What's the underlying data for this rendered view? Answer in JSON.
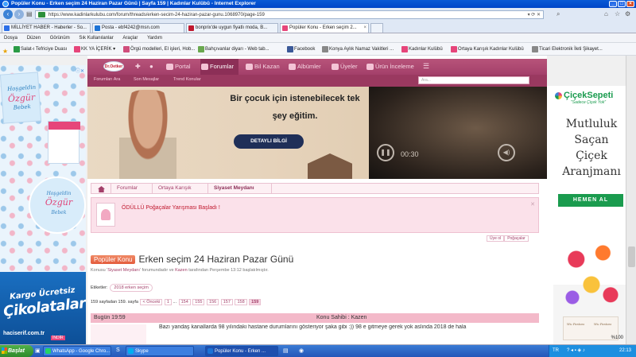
{
  "window": {
    "title": "Popüler Konu - Erken seçim 24 Haziran Pazar Günü | Sayfa 159 | Kadınlar Kulübü - Internet Explorer"
  },
  "address": {
    "url": "https://www.kadinlarkulubu.com/forum/threads/erken-secim-24-haziran-pazar-gunu.1068970/page-159"
  },
  "tabs": [
    {
      "label": "MİLLİYET HABER - Haberler - So...",
      "color": "#2a6ee8"
    },
    {
      "label": "Posta - ebf4242@msn.com",
      "color": "#1c73d6"
    },
    {
      "label": "bonprix'de uygun fiyatlı moda, B...",
      "color": "#c0182e"
    },
    {
      "label": "Popüler Konu - Erken seçim 2...",
      "color": "#e6457a"
    }
  ],
  "menu": [
    "Dosya",
    "Düzen",
    "Görünüm",
    "Sık Kullanılanlar",
    "Araçlar",
    "Yardım"
  ],
  "favorites": [
    {
      "label": "Salat-ı Tefriciye Duası",
      "color": "#2a9b46"
    },
    {
      "label": "KK YA İÇERİK",
      "color": "#e6457a"
    },
    {
      "label": "Örgü modelleri, El işleri, Hob...",
      "color": "#d04e7c"
    },
    {
      "label": "Bahçıvanlar diyarı - Web tab...",
      "color": "#6aa84f"
    },
    {
      "label": "Facebook",
      "color": "#3b5998"
    },
    {
      "label": "Konya Aylık Namaz Vakitleri ...",
      "color": "#888888"
    },
    {
      "label": "Kadınlar Kulübü",
      "color": "#e6457a"
    },
    {
      "label": "Ortaya Karışık  Kadınlar Kulübü",
      "color": "#e6457a"
    },
    {
      "label": "Ticari Elektronik İleti Şikayet...",
      "color": "#888888"
    }
  ],
  "site_nav": {
    "items": [
      "Portal",
      "Forumlar",
      "Bil Kazan",
      "Albümler",
      "Üyeler",
      "Ürün İnceleme"
    ],
    "active": "Forumlar",
    "logo": "Dr.Oetker",
    "sub": [
      "Forumları Ara",
      "Son Mesajlar",
      "Trend Konular"
    ],
    "search_placeholder": "Ara..."
  },
  "video_ad": {
    "headline": "Bir çocuk için istenebilecek tek şey eğitim.",
    "button": "DETAYLI BİLGİ",
    "time": "00:30"
  },
  "breadcrumb": [
    "Forumlar",
    "Ortaya Karışık",
    "Siyaset Meydanı"
  ],
  "notice": {
    "text": "ÖDÜLLÜ Poğaçalar Yarışması Başladı !"
  },
  "user_links": [
    "Üye ol",
    "Poğaçalar"
  ],
  "thread": {
    "badge": "Popüler Konu",
    "title": "Erken seçim 24 Haziran Pazar Günü",
    "info_prefix": "Konusu '",
    "forum": "Siyaset Meydanı",
    "info_mid": "' forumundadır ve ",
    "author": "Kazen",
    "info_suffix": " tarafından Perşembe 13:12 başlatılmıştır.",
    "tags_label": "Etiketler:",
    "tag": "2018 erken seçim"
  },
  "pager": {
    "label": "159 sayfadan 159. sayfa",
    "prev": "< Önceki",
    "first": "1",
    "dots": "...",
    "pages": [
      "154",
      "155",
      "156",
      "157",
      "158",
      "159"
    ],
    "current": "159"
  },
  "post": {
    "date": "Bugün 19:59",
    "owner": "Konu Sahibi : Kazen",
    "text": "Bazı yandaş kanallarda 98 yılındaki hastane durumlarını gösteriyor şaka gibi :)) 98 e gitmeye gerek yok aslında 2018 de hala"
  },
  "left_ad": {
    "card_top": "Hoşgeldin",
    "card_name": "Özgür",
    "card_bottom": "Bebek",
    "circle_top": "Hoşgeldin",
    "circle_name": "Özgür",
    "circle_bottom": "Bebek",
    "line1": "Kargo Ücretsiz",
    "line2": "Çikolataları",
    "site": "haciserif.com.tr",
    "tag": "İNDİR"
  },
  "right_ad": {
    "brand": "ÇiçekSepeti",
    "slogan": "\"Sadece Çiçek Yok\"",
    "big1": "Mutluluk",
    "big2": "Saçan",
    "big3": "Çiçek",
    "big4": "Aranjmanı",
    "cta": "HEMEN AL",
    "card1": "Wu Pastası",
    "card2": "Wu Pastası"
  },
  "status": {
    "zoom": "%100"
  },
  "taskbar": {
    "start": "Başlat",
    "items": [
      {
        "label": "WhatsApp - Google Chro...",
        "color": "#25d366"
      },
      {
        "label": "Skype",
        "color": "#00aff0"
      },
      {
        "label": "Popüler Konu - Erken ...",
        "color": "#1c73d6"
      }
    ],
    "lang": "TR",
    "time": "22:13"
  },
  "colors": {
    "site_bar": "#a3406a",
    "accent": "#c0182e",
    "badge": "#e35b3c"
  }
}
